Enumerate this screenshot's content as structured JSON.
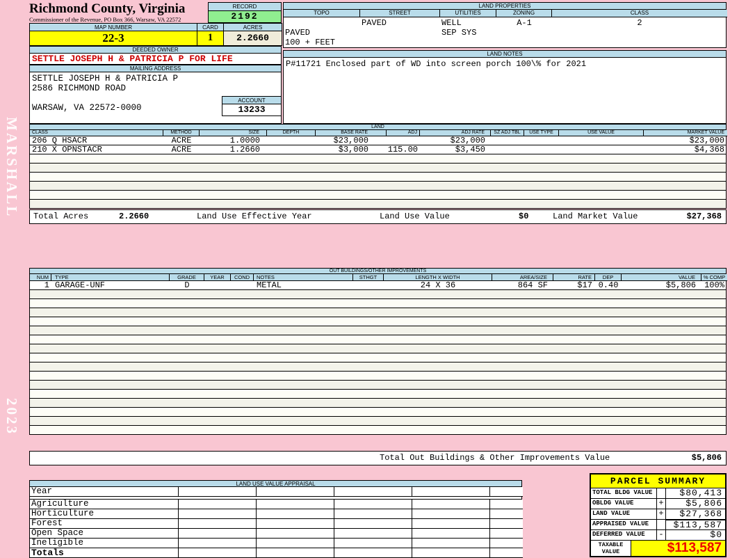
{
  "colors": {
    "page_bg": "#f9c6d2",
    "section_header_bg": "#b9dcea",
    "record_bg": "#90ee90",
    "highlight_yellow": "#ffff00",
    "acres_bg": "#f0ecda",
    "owner_text": "#cc0000",
    "taxable_text": "#ee0000"
  },
  "sidebar": {
    "vendor": "MARSHALL",
    "year": "2023"
  },
  "header": {
    "county": "Richmond County, Virginia",
    "commissioner": "Commissioner of the Revenue, PO Box 366, Warsaw, VA 22572",
    "record_label": "RECORD",
    "record_value": "2192",
    "map_number_label": "MAP NUMBER",
    "map_number_value": "22-3",
    "card_label": "CARD",
    "card_value": "1",
    "acres_label": "ACRES",
    "acres_value": "2.2660"
  },
  "land_properties": {
    "title": "LAND PROPERTIES",
    "columns": [
      "TOPO",
      "STREET",
      "UTILITIES",
      "ZONING",
      "CLASS"
    ],
    "rows": [
      [
        "",
        "PAVED",
        "WELL",
        "A-1",
        "2"
      ],
      [
        "PAVED",
        "",
        "SEP SYS",
        "",
        ""
      ],
      [
        "100 + FEET",
        "",
        "",
        "",
        ""
      ]
    ]
  },
  "land_notes": {
    "title": "LAND NOTES",
    "text": "P#11721 Enclosed part of WD into screen porch 100\\% for 2021"
  },
  "owner": {
    "deeded_owner_label": "DEEDED OWNER",
    "deeded_owner": "SETTLE JOSEPH H & PATRICIA P FOR LIFE",
    "mailing_address_label": "MAILING ADDRESS",
    "address_lines": [
      "SETTLE JOSEPH H & PATRICIA P",
      "2586 RICHMOND ROAD",
      "",
      "WARSAW, VA 22572-0000"
    ],
    "account_label": "ACCOUNT",
    "account_value": "13233"
  },
  "land": {
    "title": "LAND",
    "columns": [
      "CLASS",
      "METHOD",
      "SIZE",
      "DEPTH",
      "BASE RATE",
      "ADJ",
      "ADJ RATE",
      "SZ ADJ TBL",
      "USE TYPE",
      "USE VALUE",
      "MARKET VALUE"
    ],
    "rows": [
      [
        "206 Q HSACR",
        "ACRE",
        "1.0000",
        "",
        "$23,000",
        "",
        "$23,000",
        "",
        "",
        "",
        "$23,000"
      ],
      [
        "210 X OPNSTACR",
        "ACRE",
        "1.2660",
        "",
        "$3,000",
        "115.00",
        "$3,450",
        "",
        "",
        "",
        "$4,368"
      ]
    ],
    "totals": {
      "total_acres_label": "Total Acres",
      "total_acres": "2.2660",
      "effective_year_label": "Land Use Effective Year",
      "use_value_label": "Land Use Value",
      "use_value": "$0",
      "market_value_label": "Land Market Value",
      "market_value": "$27,368"
    }
  },
  "out_buildings": {
    "title": "OUT BUILDINGS/OTHER IMPROVEMENTS",
    "columns": [
      "NUM",
      "TYPE",
      "GRADE",
      "YEAR",
      "COND",
      "NOTES",
      "STHGT",
      "LENGTH X WIDTH",
      "AREA/SIZE",
      "RATE",
      "DEP",
      "VALUE",
      "% COMP"
    ],
    "rows": [
      [
        "1",
        "GARAGE-UNF",
        "D",
        "",
        "",
        "METAL",
        "",
        "24 X 36",
        "864 SF",
        "$17",
        "0.40",
        "$5,806",
        "100%"
      ]
    ],
    "total_label": "Total Out Buildings & Other Improvements Value",
    "total_value": "$5,806"
  },
  "land_use_appraisal": {
    "title": "LAND USE VALUE APPRAISAL",
    "row_labels": [
      "Year",
      "Agriculture",
      "Horticulture",
      "Forest",
      "Open Space",
      "Ineligible",
      "Totals"
    ]
  },
  "parcel_summary": {
    "title": "PARCEL SUMMARY",
    "rows": [
      {
        "label": "TOTAL BLDG VALUE",
        "op": "",
        "value": "$80,413"
      },
      {
        "label": "OBLDG VALUE",
        "op": "+",
        "value": "$5,806"
      },
      {
        "label": "LAND VALUE",
        "op": "+",
        "value": "$27,368"
      },
      {
        "label": "APPRAISED VALUE",
        "op": "",
        "value": "$113,587"
      },
      {
        "label": "DEFERRED VALUE",
        "op": "-",
        "value": "$0"
      }
    ],
    "taxable_label": "TAXABLE VALUE",
    "taxable_value": "$113,587"
  }
}
